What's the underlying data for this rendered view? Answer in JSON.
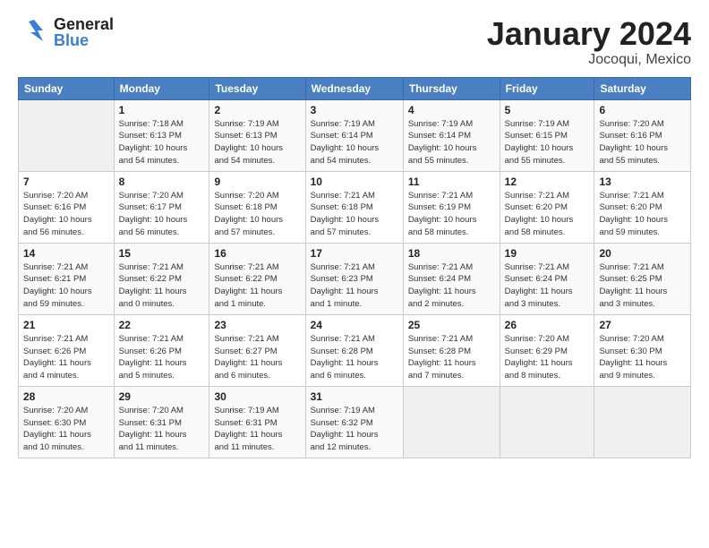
{
  "header": {
    "logo_general": "General",
    "logo_blue": "Blue",
    "month": "January 2024",
    "location": "Jocoqui, Mexico"
  },
  "days_of_week": [
    "Sunday",
    "Monday",
    "Tuesday",
    "Wednesday",
    "Thursday",
    "Friday",
    "Saturday"
  ],
  "weeks": [
    [
      {
        "day": "",
        "info": ""
      },
      {
        "day": "1",
        "info": "Sunrise: 7:18 AM\nSunset: 6:13 PM\nDaylight: 10 hours\nand 54 minutes."
      },
      {
        "day": "2",
        "info": "Sunrise: 7:19 AM\nSunset: 6:13 PM\nDaylight: 10 hours\nand 54 minutes."
      },
      {
        "day": "3",
        "info": "Sunrise: 7:19 AM\nSunset: 6:14 PM\nDaylight: 10 hours\nand 54 minutes."
      },
      {
        "day": "4",
        "info": "Sunrise: 7:19 AM\nSunset: 6:14 PM\nDaylight: 10 hours\nand 55 minutes."
      },
      {
        "day": "5",
        "info": "Sunrise: 7:19 AM\nSunset: 6:15 PM\nDaylight: 10 hours\nand 55 minutes."
      },
      {
        "day": "6",
        "info": "Sunrise: 7:20 AM\nSunset: 6:16 PM\nDaylight: 10 hours\nand 55 minutes."
      }
    ],
    [
      {
        "day": "7",
        "info": "Sunrise: 7:20 AM\nSunset: 6:16 PM\nDaylight: 10 hours\nand 56 minutes."
      },
      {
        "day": "8",
        "info": "Sunrise: 7:20 AM\nSunset: 6:17 PM\nDaylight: 10 hours\nand 56 minutes."
      },
      {
        "day": "9",
        "info": "Sunrise: 7:20 AM\nSunset: 6:18 PM\nDaylight: 10 hours\nand 57 minutes."
      },
      {
        "day": "10",
        "info": "Sunrise: 7:21 AM\nSunset: 6:18 PM\nDaylight: 10 hours\nand 57 minutes."
      },
      {
        "day": "11",
        "info": "Sunrise: 7:21 AM\nSunset: 6:19 PM\nDaylight: 10 hours\nand 58 minutes."
      },
      {
        "day": "12",
        "info": "Sunrise: 7:21 AM\nSunset: 6:20 PM\nDaylight: 10 hours\nand 58 minutes."
      },
      {
        "day": "13",
        "info": "Sunrise: 7:21 AM\nSunset: 6:20 PM\nDaylight: 10 hours\nand 59 minutes."
      }
    ],
    [
      {
        "day": "14",
        "info": "Sunrise: 7:21 AM\nSunset: 6:21 PM\nDaylight: 10 hours\nand 59 minutes."
      },
      {
        "day": "15",
        "info": "Sunrise: 7:21 AM\nSunset: 6:22 PM\nDaylight: 11 hours\nand 0 minutes."
      },
      {
        "day": "16",
        "info": "Sunrise: 7:21 AM\nSunset: 6:22 PM\nDaylight: 11 hours\nand 1 minute."
      },
      {
        "day": "17",
        "info": "Sunrise: 7:21 AM\nSunset: 6:23 PM\nDaylight: 11 hours\nand 1 minute."
      },
      {
        "day": "18",
        "info": "Sunrise: 7:21 AM\nSunset: 6:24 PM\nDaylight: 11 hours\nand 2 minutes."
      },
      {
        "day": "19",
        "info": "Sunrise: 7:21 AM\nSunset: 6:24 PM\nDaylight: 11 hours\nand 3 minutes."
      },
      {
        "day": "20",
        "info": "Sunrise: 7:21 AM\nSunset: 6:25 PM\nDaylight: 11 hours\nand 3 minutes."
      }
    ],
    [
      {
        "day": "21",
        "info": "Sunrise: 7:21 AM\nSunset: 6:26 PM\nDaylight: 11 hours\nand 4 minutes."
      },
      {
        "day": "22",
        "info": "Sunrise: 7:21 AM\nSunset: 6:26 PM\nDaylight: 11 hours\nand 5 minutes."
      },
      {
        "day": "23",
        "info": "Sunrise: 7:21 AM\nSunset: 6:27 PM\nDaylight: 11 hours\nand 6 minutes."
      },
      {
        "day": "24",
        "info": "Sunrise: 7:21 AM\nSunset: 6:28 PM\nDaylight: 11 hours\nand 6 minutes."
      },
      {
        "day": "25",
        "info": "Sunrise: 7:21 AM\nSunset: 6:28 PM\nDaylight: 11 hours\nand 7 minutes."
      },
      {
        "day": "26",
        "info": "Sunrise: 7:20 AM\nSunset: 6:29 PM\nDaylight: 11 hours\nand 8 minutes."
      },
      {
        "day": "27",
        "info": "Sunrise: 7:20 AM\nSunset: 6:30 PM\nDaylight: 11 hours\nand 9 minutes."
      }
    ],
    [
      {
        "day": "28",
        "info": "Sunrise: 7:20 AM\nSunset: 6:30 PM\nDaylight: 11 hours\nand 10 minutes."
      },
      {
        "day": "29",
        "info": "Sunrise: 7:20 AM\nSunset: 6:31 PM\nDaylight: 11 hours\nand 11 minutes."
      },
      {
        "day": "30",
        "info": "Sunrise: 7:19 AM\nSunset: 6:31 PM\nDaylight: 11 hours\nand 11 minutes."
      },
      {
        "day": "31",
        "info": "Sunrise: 7:19 AM\nSunset: 6:32 PM\nDaylight: 11 hours\nand 12 minutes."
      },
      {
        "day": "",
        "info": ""
      },
      {
        "day": "",
        "info": ""
      },
      {
        "day": "",
        "info": ""
      }
    ]
  ]
}
